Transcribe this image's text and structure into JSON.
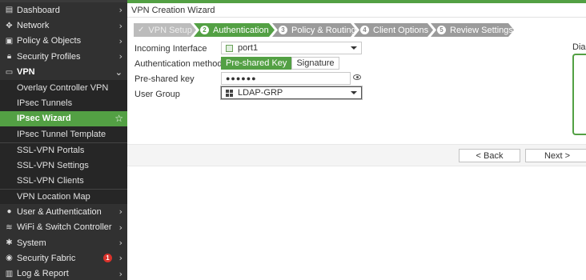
{
  "sidebar": {
    "items": [
      {
        "icon": "dashboard-icon",
        "glyph": "▤",
        "label": "Dashboard"
      },
      {
        "icon": "network-icon",
        "glyph": "✥",
        "label": "Network"
      },
      {
        "icon": "policy-icon",
        "glyph": "▣",
        "label": "Policy & Objects"
      },
      {
        "icon": "lock-icon",
        "glyph": "🔒︎",
        "label": "Security Profiles"
      },
      {
        "icon": "monitor-icon",
        "glyph": "▭",
        "label": "VPN"
      }
    ],
    "vpn_subitems": [
      "Overlay Controller VPN",
      "IPsec Tunnels",
      "IPsec Wizard",
      "IPsec Tunnel Template",
      "SSL-VPN Portals",
      "SSL-VPN Settings",
      "SSL-VPN Clients",
      "VPN Location Map"
    ],
    "items_after": [
      {
        "icon": "user-icon",
        "glyph": "●",
        "label": "User & Authentication"
      },
      {
        "icon": "wifi-icon",
        "glyph": "≋",
        "label": "WiFi & Switch Controller"
      },
      {
        "icon": "gear-icon",
        "glyph": "✱",
        "label": "System"
      },
      {
        "icon": "fabric-icon",
        "glyph": "◉",
        "label": "Security Fabric",
        "badge": "1"
      },
      {
        "icon": "chart-icon",
        "glyph": "▥",
        "label": "Log & Report"
      }
    ]
  },
  "wizard": {
    "title": "VPN Creation Wizard",
    "steps": [
      {
        "num": "",
        "label": "VPN Setup"
      },
      {
        "num": "2",
        "label": "Authentication"
      },
      {
        "num": "3",
        "label": "Policy & Routing"
      },
      {
        "num": "4",
        "label": "Client Options"
      },
      {
        "num": "5",
        "label": "Review Settings"
      }
    ],
    "form": {
      "incoming_interface_label": "Incoming Interface",
      "incoming_interface_value": "port1",
      "auth_method_label": "Authentication method",
      "auth_options": [
        "Pre-shared Key",
        "Signature"
      ],
      "psk_label": "Pre-shared key",
      "psk_value": "●●●●●●",
      "user_group_label": "User Group",
      "user_group_value": "LDAP-GRP"
    },
    "dialog_label": "Dial",
    "buttons": {
      "back": "< Back",
      "next": "Next >"
    }
  },
  "colors": {
    "accent": "#53a044",
    "sidebar": "#313131"
  }
}
